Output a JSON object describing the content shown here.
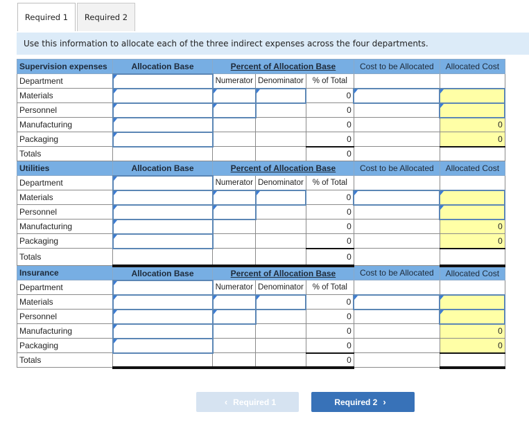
{
  "tabs": [
    {
      "label": "Required 1",
      "active": true
    },
    {
      "label": "Required 2",
      "active": false
    }
  ],
  "instruction": "Use this information to allocate each of the three indirect expenses across the four departments.",
  "columns": {
    "allocation_base": "Allocation Base",
    "percent": "Percent of Allocation Base",
    "cost_to_allocate": "Cost to be Allocated",
    "allocated_cost": "Allocated Cost",
    "numerator": "Numerator",
    "denominator": "Denominator",
    "pct_total": "% of Total"
  },
  "labels": {
    "department": "Department",
    "totals": "Totals"
  },
  "sections": [
    {
      "title": "Supervision expenses",
      "rows": [
        {
          "name": "Materials",
          "pct": "0",
          "allocated": ""
        },
        {
          "name": "Personnel",
          "pct": "0",
          "allocated": ""
        },
        {
          "name": "Manufacturing",
          "pct": "0",
          "allocated": "0"
        },
        {
          "name": "Packaging",
          "pct": "0",
          "allocated": "0"
        }
      ],
      "total_pct": "0"
    },
    {
      "title": "Utilities",
      "rows": [
        {
          "name": "Materials",
          "pct": "0",
          "allocated": ""
        },
        {
          "name": "Personnel",
          "pct": "0",
          "allocated": ""
        },
        {
          "name": "Manufacturing",
          "pct": "0",
          "allocated": "0"
        },
        {
          "name": "Packaging",
          "pct": "0",
          "allocated": "0"
        }
      ],
      "total_pct": "0"
    },
    {
      "title": "Insurance",
      "rows": [
        {
          "name": "Materials",
          "pct": "0",
          "allocated": ""
        },
        {
          "name": "Personnel",
          "pct": "0",
          "allocated": ""
        },
        {
          "name": "Manufacturing",
          "pct": "0",
          "allocated": "0"
        },
        {
          "name": "Packaging",
          "pct": "0",
          "allocated": "0"
        }
      ],
      "total_pct": "0"
    }
  ],
  "nav": {
    "prev_label": "Required 1",
    "next_label": "Required 2",
    "prev_chevron": "‹",
    "next_chevron": "›"
  },
  "colors": {
    "header_bg": "#77aee3",
    "instruction_bg": "#dcebf8",
    "computed_cell": "#ffffa6",
    "next_button": "#3872b8",
    "prev_button_disabled": "#d6e3f1"
  }
}
